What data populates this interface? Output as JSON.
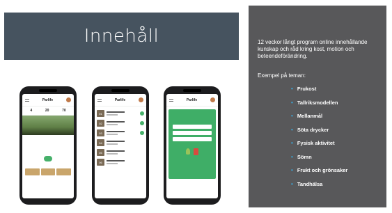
{
  "slide": {
    "title": "Innehåll"
  },
  "panel": {
    "intro": "12 veckor långt program online innehållande kunskap och råd kring kost, motion och beteendeförändring.",
    "subhead": "Exempel på teman:",
    "topics": [
      "Frukost",
      "Tallriksmodellen",
      "Mellanmål",
      "Söta drycker",
      "Fysisk aktivitet",
      "Sömn",
      "Frukt och grönsaker",
      "Tandhälsa"
    ],
    "colors": {
      "banner": "#46535f",
      "panel": "#58585a",
      "bullet": "#3ba7d9",
      "accent": "#46b06a"
    }
  },
  "phones": {
    "brand": "Parlife"
  }
}
